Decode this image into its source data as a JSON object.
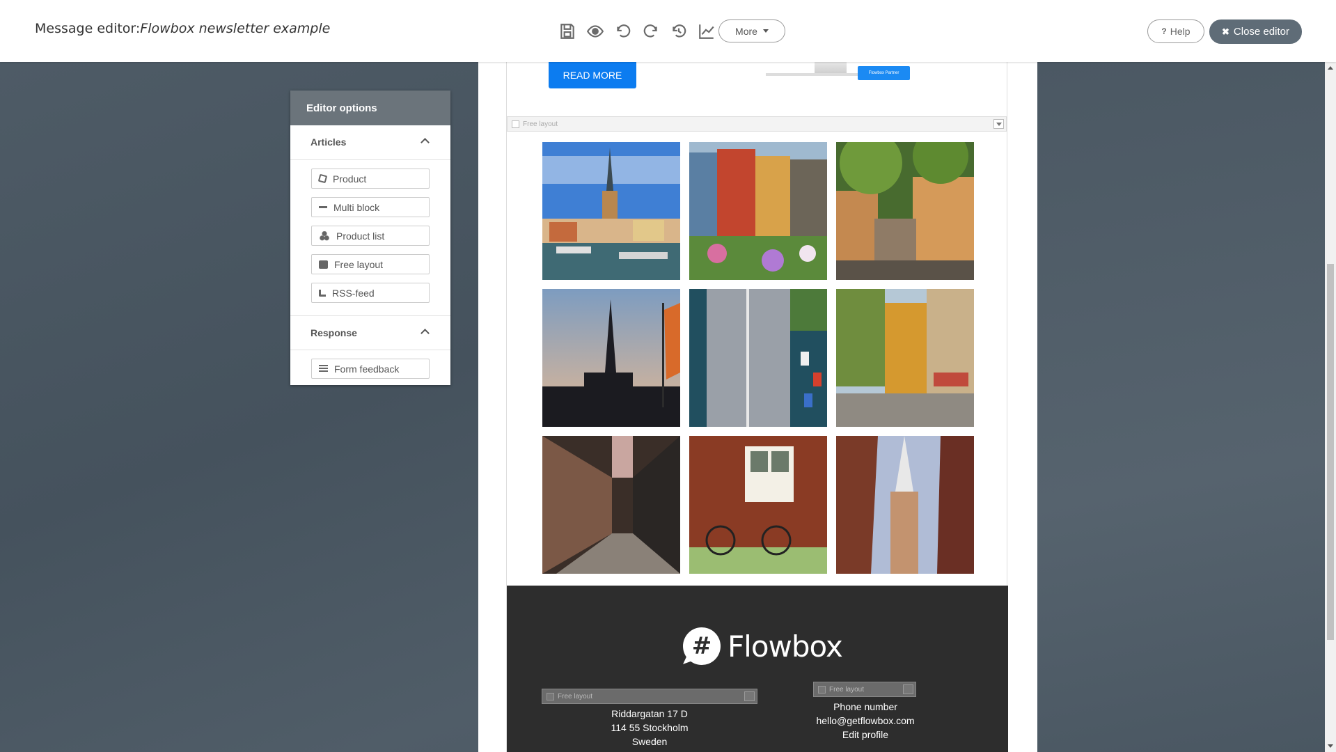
{
  "header": {
    "title_prefix": "Message editor:",
    "title_doc": "Flowbox newsletter example",
    "more_label": "More",
    "help_label": "Help",
    "close_label": "Close editor"
  },
  "toolbar_icons": [
    "save-icon",
    "preview-eye-icon",
    "undo-icon",
    "redo-icon",
    "history-icon",
    "stats-chart-icon"
  ],
  "panel": {
    "title": "Editor options",
    "articles": {
      "heading": "Articles",
      "items": [
        {
          "label": "Product",
          "icon": "cube-icon"
        },
        {
          "label": "Multi block",
          "icon": "dash-icon"
        },
        {
          "label": "Product list",
          "icon": "cubes-icon"
        },
        {
          "label": "Free layout",
          "icon": "square-icon"
        },
        {
          "label": "RSS-feed",
          "icon": "rss-icon"
        }
      ]
    },
    "response": {
      "heading": "Response",
      "items": [
        {
          "label": "Form feedback",
          "icon": "list-icon"
        }
      ]
    }
  },
  "newsletter": {
    "read_more": "READ MORE",
    "partner_badge": "Flowbox Partner",
    "free_layout_label": "Free layout",
    "logo_text": "Flowbox",
    "address": [
      "Riddargatan 17 D",
      "114 55 Stockholm",
      "Sweden"
    ],
    "contact": [
      "Phone number",
      "hello@getflowbox.com",
      "Edit profile"
    ]
  },
  "colors": {
    "accent_blue": "#0c7cf0",
    "close_button": "#5f6c77",
    "panel_header": "#6b747b",
    "footer_bg": "#2d2d2d",
    "background": "#4a5763"
  }
}
